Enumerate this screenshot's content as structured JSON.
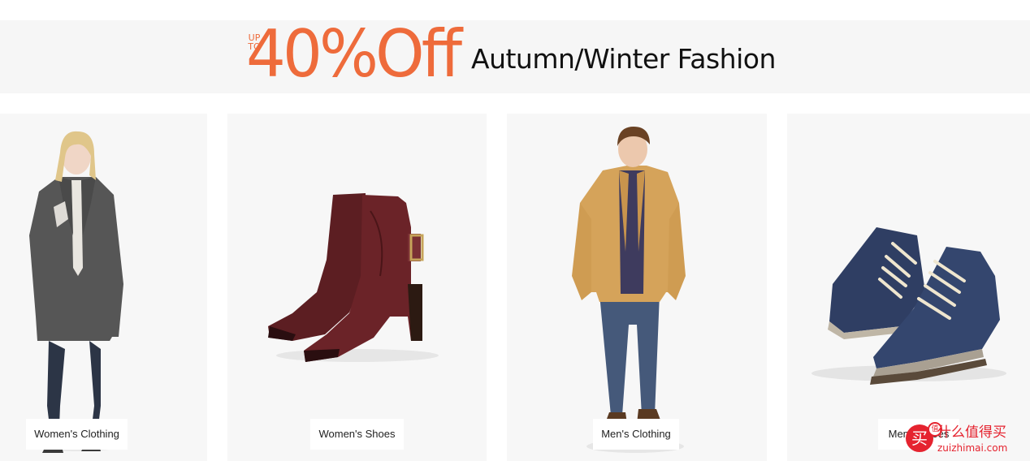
{
  "banner": {
    "up_line1": "UP",
    "up_line2": "TO",
    "discount": "40%Off",
    "headline": "Autumn/Winter Fashion",
    "accent_color": "#ee6b3b"
  },
  "categories": [
    {
      "label": "Women's Clothing",
      "image": "woman-in-grey-coat"
    },
    {
      "label": "Women's Shoes",
      "image": "burgundy-ankle-boots"
    },
    {
      "label": "Men's Clothing",
      "image": "man-in-tan-jacket"
    },
    {
      "label": "Men's Shoes",
      "image": "navy-hiking-boots"
    }
  ],
  "watermark": {
    "logo_char": "买",
    "badge_char": "值",
    "site_name": "什么值得买",
    "url": "zuizhimai.com",
    "color": "#e5232f"
  }
}
